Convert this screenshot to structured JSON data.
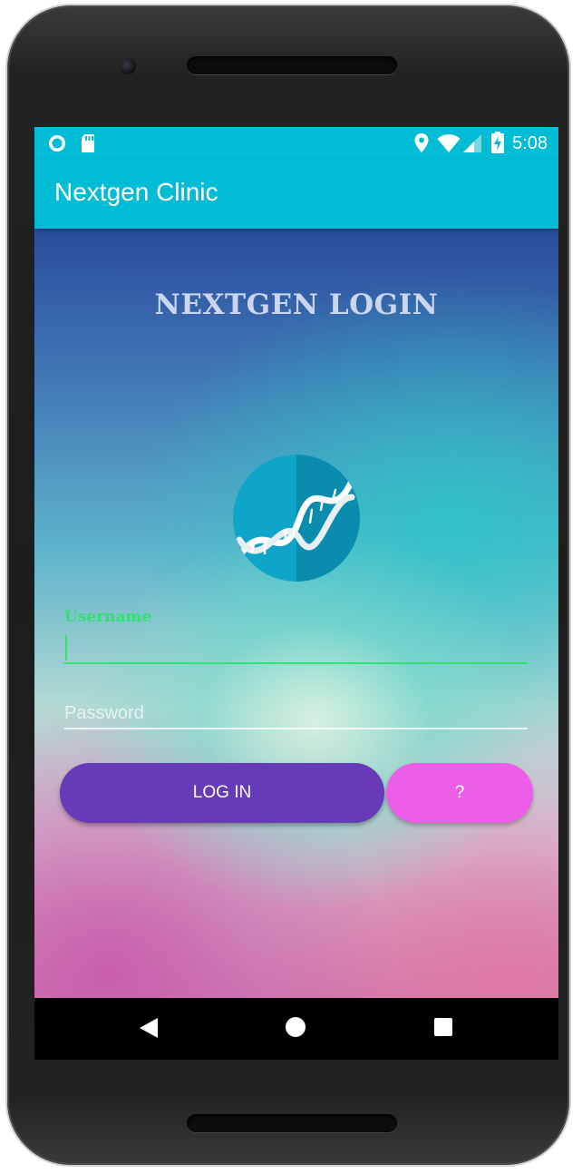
{
  "status_bar": {
    "time": "5:08",
    "left_icons": [
      "circle-notification-icon",
      "sd-card-icon"
    ],
    "right_icons": [
      "location-icon",
      "wifi-icon",
      "signal-icon",
      "battery-charging-icon"
    ]
  },
  "app_bar": {
    "title": "Nextgen Clinic"
  },
  "login": {
    "heading": "NEXTGEN LOGIN",
    "logo_icon": "dna-icon",
    "username_label": "Username",
    "username_value": "",
    "password_placeholder": "Password",
    "password_value": "",
    "login_button": "LOG IN",
    "help_button": "?"
  },
  "nav_bar": {
    "icons": [
      "back-icon",
      "home-icon",
      "recents-icon"
    ]
  },
  "colors": {
    "app_bar": "#00bcd4",
    "accent_green": "#33e070",
    "login_button": "#673ab7",
    "help_button": "#ec5ee8"
  }
}
